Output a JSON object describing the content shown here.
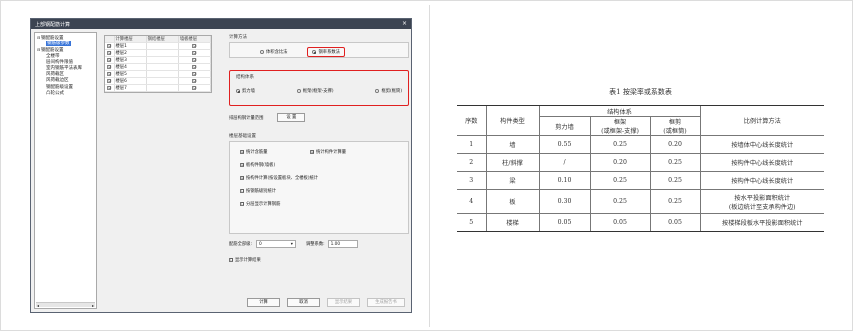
{
  "dialog": {
    "title": "上部钢配筋计算",
    "close": "×",
    "tree": [
      {
        "label": "钢配筋设置",
        "level": 0,
        "expander": "⊟"
      },
      {
        "label": "钢筋级参数",
        "level": 1,
        "selected": true
      },
      {
        "label": "钢配筋设置",
        "level": 0,
        "expander": "⊟"
      },
      {
        "label": "全楼带",
        "level": 1
      },
      {
        "label": "层间构件限值",
        "level": 1
      },
      {
        "label": "室内钢筋平法表库",
        "level": 1
      },
      {
        "label": "风荷载区",
        "level": 1
      },
      {
        "label": "风荷载边区",
        "level": 1
      },
      {
        "label": "钢配筋级设置",
        "level": 1
      },
      {
        "label": "凸轮公式",
        "level": 1
      }
    ],
    "grid": {
      "headers": [
        "",
        "计算楼层",
        "钢结楼层",
        "墙板楼层"
      ],
      "rows": [
        {
          "name": "楼层1",
          "c1": "☑",
          "c3": "☑"
        },
        {
          "name": "楼层2",
          "c1": "☑",
          "c3": "☑"
        },
        {
          "name": "楼层3",
          "c1": "☑",
          "c3": "☑"
        },
        {
          "name": "楼层4",
          "c1": "☑",
          "c3": "☑"
        },
        {
          "name": "楼层5",
          "c1": "☑",
          "c3": "☑"
        },
        {
          "name": "楼层6",
          "c1": "☑",
          "c3": "☑"
        },
        {
          "name": "楼层7",
          "c1": "☑",
          "c3": "☑"
        }
      ]
    },
    "calc_method": {
      "title": "计算方法",
      "opt1": "体积含比法",
      "opt2": "钢率系数法"
    },
    "structure": {
      "title": "结构体系",
      "opt1": "剪力墙",
      "opt2": "框架(框架-支撑)",
      "opt3": "框剪(框筒)"
    },
    "coef_row": {
      "label": "排层构钢计量范围",
      "button": "设 置"
    },
    "options": {
      "title": "楼层基础设置",
      "items": [
        {
          "label": "统计含筋量",
          "checked": "☑"
        },
        {
          "label": "统计构件计算量",
          "checked": "☑"
        },
        {
          "label": "板构件钢(墙板)",
          "checked": "☑"
        },
        {
          "label": "按构件计算(按设置板块、全楼板)统计",
          "checked": "☑"
        },
        {
          "label": "按钢筋级别统计",
          "checked": "☐"
        },
        {
          "label": "分层显示计算钢筋",
          "checked": "☐"
        }
      ]
    },
    "params": {
      "label1": "配筋全部级:",
      "value1": "0",
      "arrow": "▾",
      "label2": "调整系数:",
      "value2": "1.00"
    },
    "extra": {
      "label": "显示计算结果",
      "checked": "☐"
    },
    "buttons": {
      "calc": "计算",
      "cancel": "取消",
      "show": "显示结果",
      "report": "生成报告书"
    },
    "scroll": {
      "left": "◂",
      "right": "▸"
    }
  },
  "table": {
    "caption": "表1 按梁率或系数表",
    "header": {
      "no": "序数",
      "type": "构件类型",
      "group": "结构体系",
      "s1": "剪力墙",
      "s2a": "框架",
      "s2b": "(或框架-支撑)",
      "s3a": "框剪",
      "s3b": "(或框筒)",
      "method": "比例计算方法"
    },
    "rows": [
      {
        "no": "1",
        "type": "墙",
        "v1": "0.55",
        "v2": "0.25",
        "v3": "0.20",
        "method": "按墙体中心线长度统计"
      },
      {
        "no": "2",
        "type": "柱/斜撑",
        "v1": "/",
        "v2": "0.20",
        "v3": "0.25",
        "method": "按构件中心线长度统计"
      },
      {
        "no": "3",
        "type": "梁",
        "v1": "0.10",
        "v2": "0.25",
        "v3": "0.25",
        "method": "按构件中心线长度统计"
      },
      {
        "no": "4",
        "type": "板",
        "v1": "0.30",
        "v2": "0.25",
        "v3": "0.25",
        "method_a": "按水平投影面积统计",
        "method_b": "(板边统计至支承构件边)"
      },
      {
        "no": "5",
        "type": "楼梯",
        "v1": "0.05",
        "v2": "0.05",
        "v3": "0.05",
        "method": "按楼梯段板水平投影面积统计"
      }
    ]
  }
}
